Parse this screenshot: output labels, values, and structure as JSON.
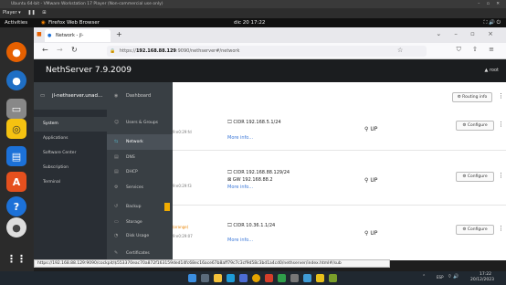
{
  "vmware": {
    "title": "Ubuntu 64-bit - VMware Workstation 17 Player (Non-commercial use only)",
    "player_label": "Player ▾",
    "controls": "– ▫ ✕"
  },
  "gnome": {
    "activities": "Activities",
    "app_name": "Firefox Web Browser",
    "clock": "dic 20 17:22"
  },
  "browser": {
    "tab_title": "Network - jl-nethserver.t",
    "url_prefix": "https://",
    "url_host": "192.168.88.129",
    "url_rest": ":9090/nethserver#/network",
    "status_url": "https://192.168.88.129:9090/cockpit/$553370eac70a872f163159ded14fc68ec16ace67b8aff79c7c3cf9d58c3bd1a4cd0/nethserver/index.html#/sub"
  },
  "cockpit": {
    "product": "NethServer 7.9.2009",
    "user": "root",
    "hostname": "jl-nethserver.unad...",
    "left_nav": [
      {
        "label": "System"
      },
      {
        "label": "Applications"
      },
      {
        "label": "Software Center"
      },
      {
        "label": "Subscription"
      },
      {
        "label": "Terminal"
      }
    ],
    "menu": [
      {
        "label": "Dashboard",
        "icon": "◉"
      },
      {
        "label": "Users & Groups",
        "icon": "👥"
      },
      {
        "label": "Network",
        "icon": "⇆"
      },
      {
        "label": "DNS",
        "icon": "▤"
      },
      {
        "label": "DHCP",
        "icon": "▤"
      },
      {
        "label": "Services",
        "icon": "⚙"
      },
      {
        "label": "Backup",
        "icon": "↺"
      },
      {
        "label": "Storage",
        "icon": "▭"
      },
      {
        "label": "Disk Usage",
        "icon": "◔"
      },
      {
        "label": "Certificates",
        "icon": "✎"
      }
    ],
    "routing_info": "Routing info",
    "interfaces": [
      {
        "cidr": "CIDR 192.168.5.1/24",
        "gw": "",
        "more": "More info...",
        "state": "UP",
        "configure": "Configure",
        "mac_frag": "9:e0:29:fd"
      },
      {
        "cidr": "CIDR 192.168.88.129/24",
        "gw": "GW 192.168.88.2",
        "more": "More info...",
        "state": "UP",
        "configure": "Configure",
        "mac_frag": "9:e0:29:f3"
      },
      {
        "cidr": "CIDR 10.36.1.1/24",
        "gw": "",
        "more": "More info...",
        "state": "UP",
        "configure": "Configure",
        "mac_frag": "9:e0:29:07",
        "role_frag": "(orange)"
      }
    ]
  },
  "taskbar": {
    "lang": "ESP",
    "time": "17:22",
    "date": "20/12/2023"
  }
}
